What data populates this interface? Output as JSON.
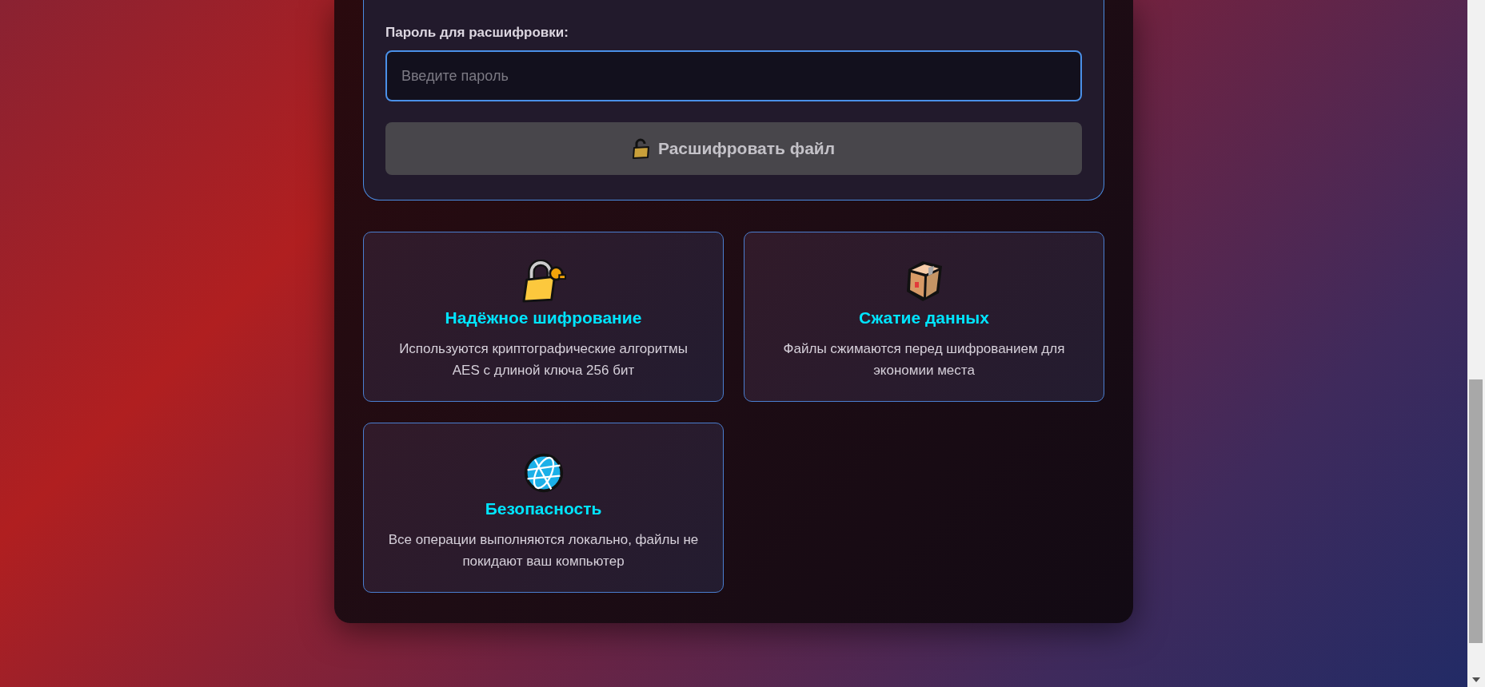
{
  "decrypt": {
    "label": "Пароль для расшифровки:",
    "password": {
      "placeholder": "Введите пароль"
    },
    "button": {
      "label": "Расшифровать файл",
      "disabled": true
    }
  },
  "features": [
    {
      "kind": "lock",
      "title": "Надёжное шифрование",
      "text": "Используются криптографические алгоритмы AES с длиной ключа 256 бит"
    },
    {
      "kind": "box",
      "title": "Сжатие данных",
      "text": "Файлы сжимаются перед шифрованием для экономии места"
    },
    {
      "kind": "globe",
      "title": "Безопасность",
      "text": "Все операции выполняются локально, файлы не покидают ваш компьютер"
    }
  ]
}
